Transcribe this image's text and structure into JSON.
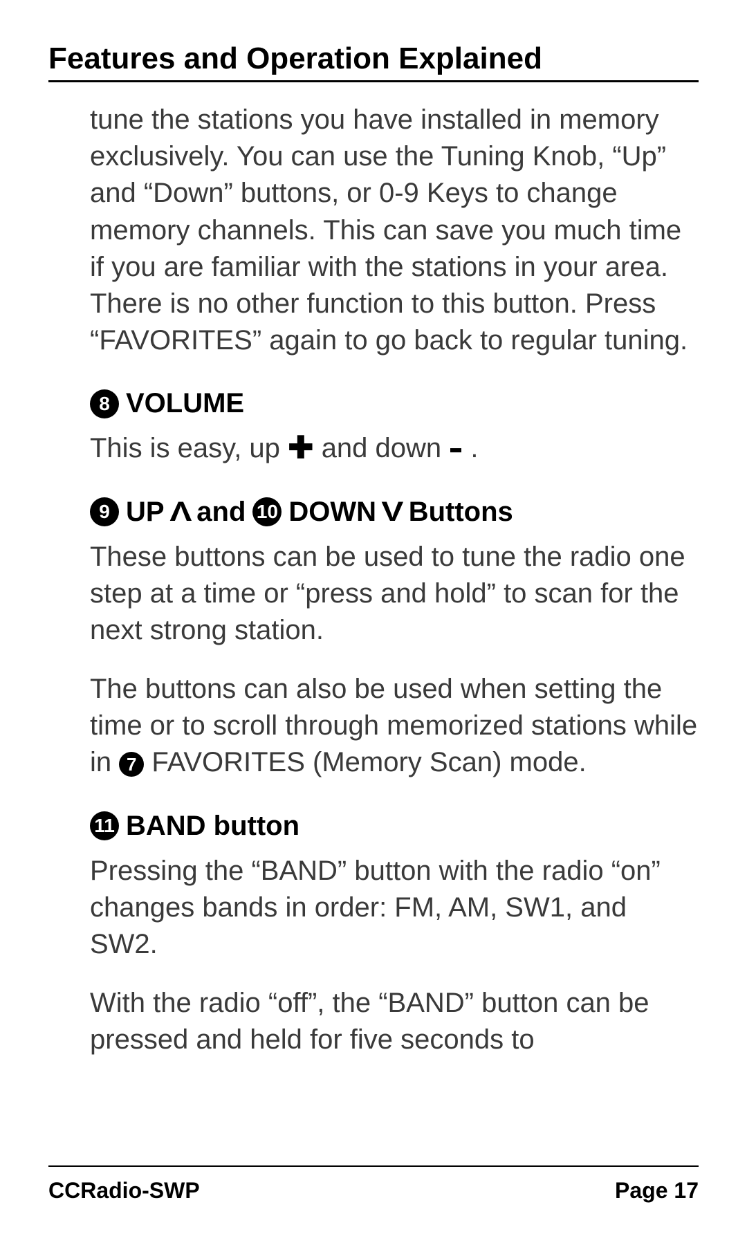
{
  "title": "Features and Operation Explained",
  "sections": {
    "intro_para": "tune the stations you have installed in memory exclusively. You can use the Tuning Knob, “Up” and “Down” buttons, or 0-9 Keys to change memory channels. This can save you much time if you are familiar with the stations in your area. There is no other function to this button. Press “FAVORITES” again to go back to regular tuning.",
    "volume": {
      "num": "8",
      "label": "VOLUME",
      "text_a": "This is easy, up ",
      "text_b": " and down ",
      "text_c": "."
    },
    "updown": {
      "numA": "9",
      "labelA": "UP",
      "and": " and ",
      "numB": "10",
      "labelB": "DOWN",
      "tail": " Buttons",
      "para1": "These buttons can be used to tune the radio one step at a time or “press and hold” to scan for the next strong station.",
      "para2a": "The buttons can also be used when setting the time or to scroll through memorized stations while in ",
      "inlineNum": "7",
      "para2b": " FAVORITES (Memory Scan) mode."
    },
    "band": {
      "num": "11",
      "label": "BAND button",
      "para1": "Pressing the “BAND” button with the radio “on” changes bands in order: FM, AM, SW1, and SW2.",
      "para2": "With the radio “off”, the “BAND” button can be pressed and held for five seconds to"
    }
  },
  "footer": {
    "left": "CCRadio-SWP",
    "right": "Page 17"
  }
}
